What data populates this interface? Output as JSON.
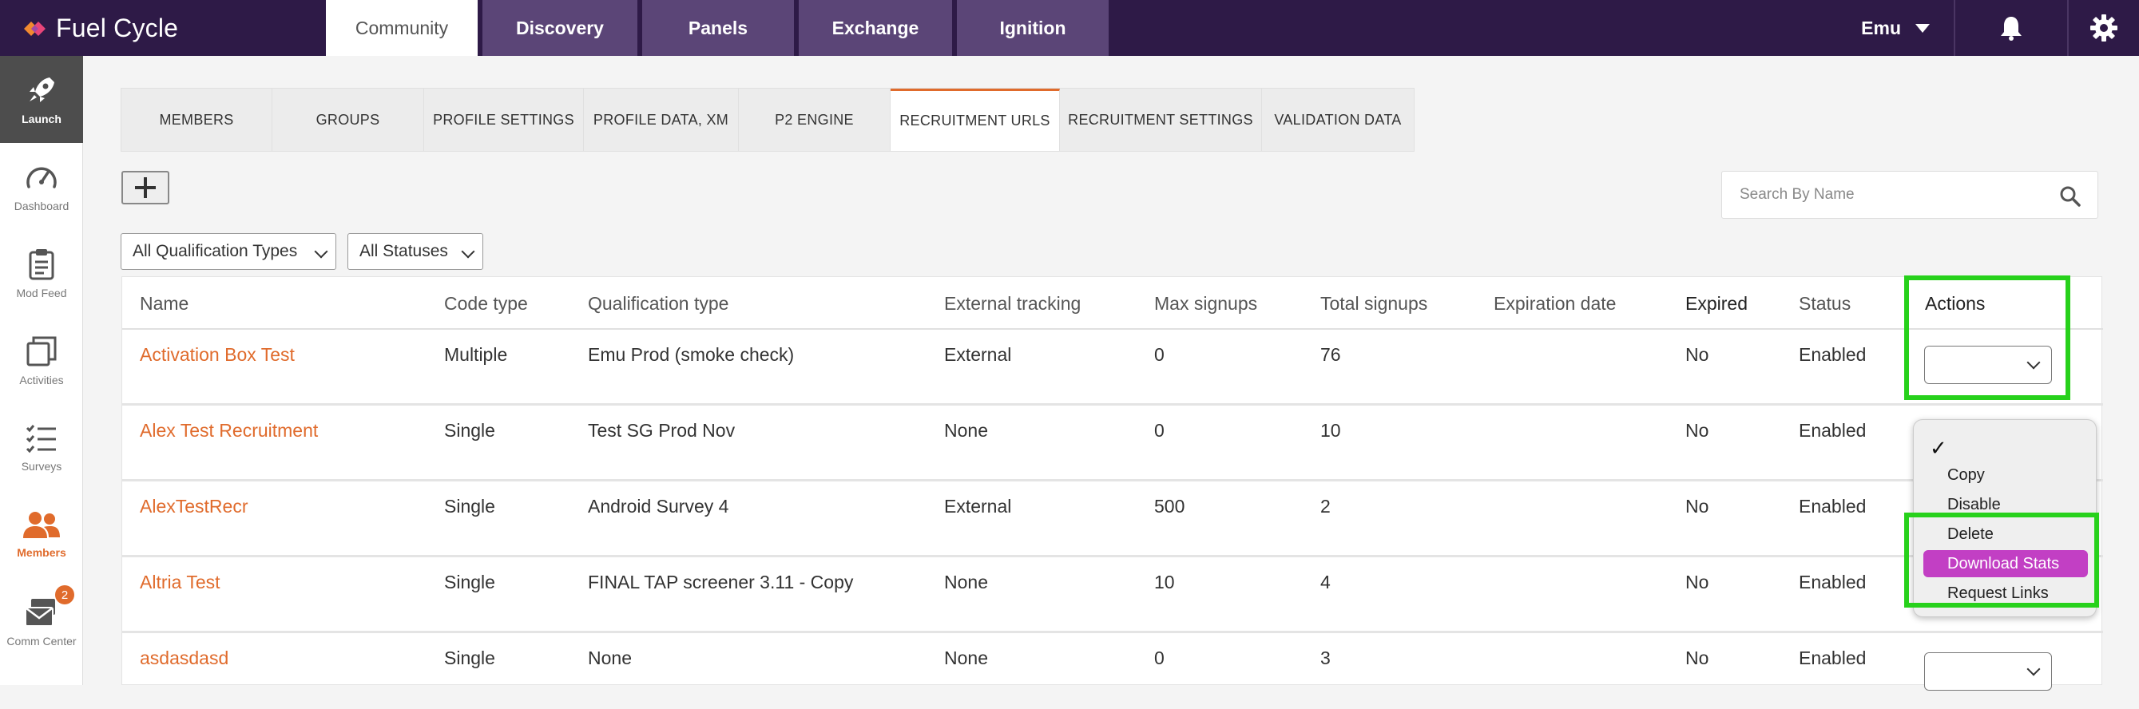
{
  "app": {
    "brand": "Fuel Cycle"
  },
  "nav": {
    "tabs": [
      {
        "label": "Community",
        "active": true
      },
      {
        "label": "Discovery"
      },
      {
        "label": "Panels"
      },
      {
        "label": "Exchange"
      },
      {
        "label": "Ignition"
      }
    ],
    "user": "Emu"
  },
  "sidebar": {
    "items": [
      {
        "label": "Launch",
        "icon": "rocket-icon"
      },
      {
        "label": "Dashboard",
        "icon": "gauge-icon"
      },
      {
        "label": "Mod Feed",
        "icon": "clipboard-icon"
      },
      {
        "label": "Activities",
        "icon": "layers-icon"
      },
      {
        "label": "Surveys",
        "icon": "checklist-icon"
      },
      {
        "label": "Members",
        "icon": "users-icon"
      },
      {
        "label": "Comm Center",
        "icon": "mail-icon",
        "badge": "2"
      }
    ]
  },
  "subtabs": [
    "MEMBERS",
    "GROUPS",
    "PROFILE SETTINGS",
    "PROFILE DATA, XM",
    "P2 ENGINE",
    "RECRUITMENT URLS",
    "RECRUITMENT SETTINGS",
    "VALIDATION DATA"
  ],
  "search": {
    "placeholder": "Search By Name"
  },
  "filters": {
    "qualification": "All Qualification Types",
    "status": "All Statuses"
  },
  "table": {
    "headers": [
      "Name",
      "Code type",
      "Qualification type",
      "External tracking",
      "Max signups",
      "Total signups",
      "Expiration date",
      "Expired",
      "Status",
      "Actions"
    ],
    "rows": [
      {
        "name": "Activation Box Test",
        "code_type": "Multiple",
        "qualification": "Emu Prod (smoke check)",
        "tracking": "External",
        "max": "0",
        "total": "76",
        "expiration": "",
        "expired": "No",
        "status": "Enabled"
      },
      {
        "name": "Alex Test Recruitment",
        "code_type": "Single",
        "qualification": "Test SG Prod Nov",
        "tracking": "None",
        "max": "0",
        "total": "10",
        "expiration": "",
        "expired": "No",
        "status": "Enabled"
      },
      {
        "name": "AlexTestRecr",
        "code_type": "Single",
        "qualification": "Android Survey 4",
        "tracking": "External",
        "max": "500",
        "total": "2",
        "expiration": "",
        "expired": "No",
        "status": "Enabled"
      },
      {
        "name": "Altria Test",
        "code_type": "Single",
        "qualification": "FINAL TAP screener 3.11 - Copy",
        "tracking": "None",
        "max": "10",
        "total": "4",
        "expiration": "",
        "expired": "No",
        "status": "Enabled"
      },
      {
        "name": "asdasdasd",
        "code_type": "Single",
        "qualification": "None",
        "tracking": "None",
        "max": "0",
        "total": "3",
        "expiration": "",
        "expired": "No",
        "status": "Enabled"
      }
    ]
  },
  "actions_menu": {
    "check": "✓",
    "items": [
      "Copy",
      "Disable",
      "Delete",
      "Download Stats",
      "Request Links"
    ],
    "selected": "Download Stats"
  },
  "colors": {
    "topbar": "#2e1a47",
    "accent": "#e06b2c",
    "highlight": "#27d11b",
    "selected": "#c23fc4"
  }
}
